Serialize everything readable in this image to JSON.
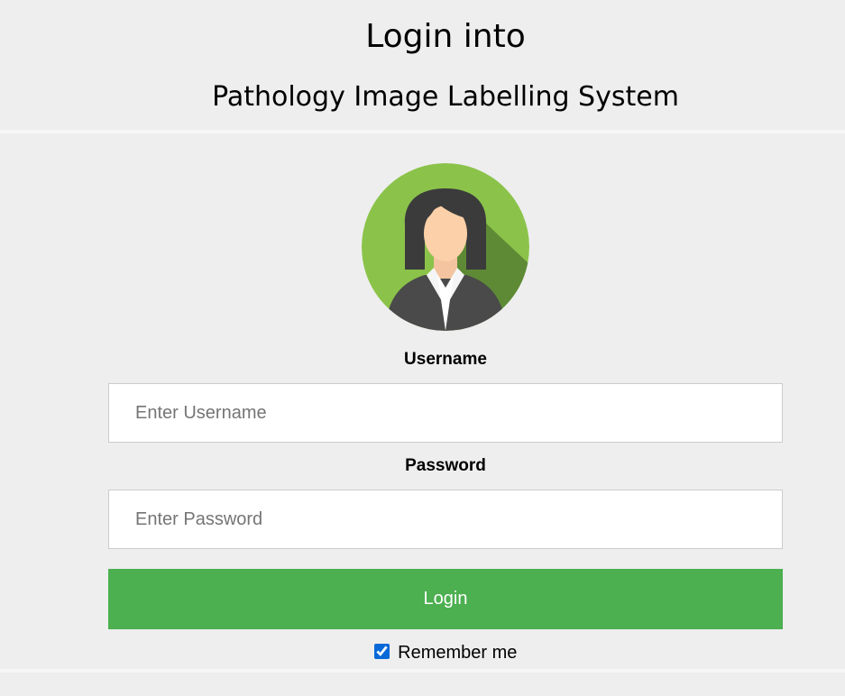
{
  "header": {
    "title": "Login into",
    "subtitle": "Pathology Image Labelling System"
  },
  "avatar": {
    "icon": "user-avatar-icon",
    "background_color": "#8bc34a"
  },
  "form": {
    "username_label": "Username",
    "username_placeholder": "Enter Username",
    "username_value": "",
    "password_label": "Password",
    "password_placeholder": "Enter Password",
    "password_value": "",
    "login_label": "Login",
    "login_color": "#4caf50",
    "remember_label": "Remember me",
    "remember_checked": true
  }
}
